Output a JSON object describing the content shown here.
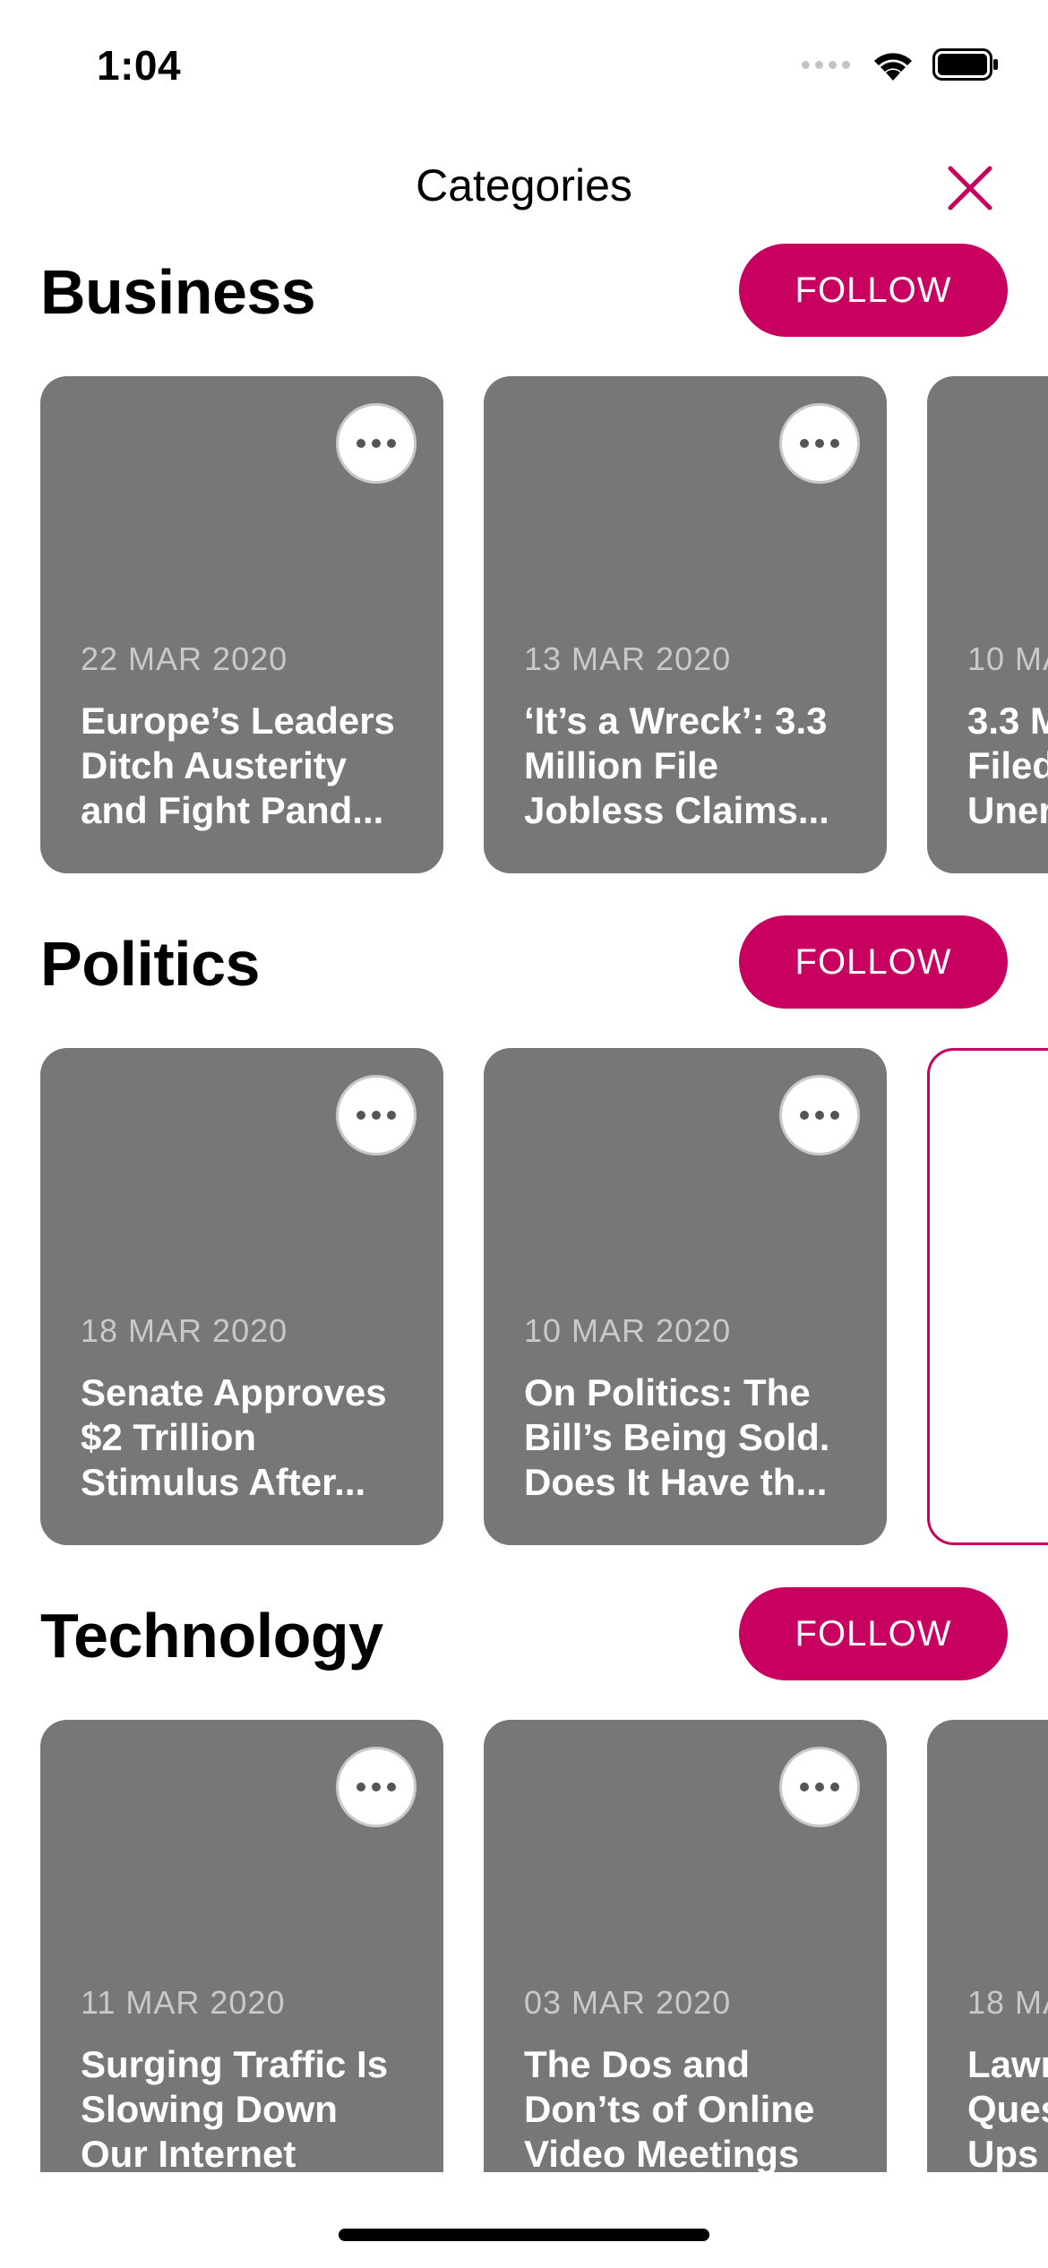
{
  "status_bar": {
    "time": "1:04"
  },
  "header": {
    "title": "Categories",
    "close_icon": "close-icon"
  },
  "colors": {
    "accent": "#c8005f",
    "card_bg": "#777777"
  },
  "sections": [
    {
      "title": "Business",
      "follow_label": "FOLLOW",
      "cards": [
        {
          "date": "22 MAR 2020",
          "headline": "Europe’s Leaders\nDitch Austerity\nand Fight Pand..."
        },
        {
          "date": "13 MAR 2020",
          "headline": "‘It’s a Wreck’: 3.3\nMillion File\nJobless Claims..."
        },
        {
          "date": "10 MA",
          "headline": "3.3 M\nFiled\nUner"
        }
      ]
    },
    {
      "title": "Politics",
      "follow_label": "FOLLOW",
      "cards": [
        {
          "date": "18 MAR 2020",
          "headline": "Senate Approves\n$2 Trillion\nStimulus After..."
        },
        {
          "date": "10 MAR 2020",
          "headline": "On Politics: The\nBill’s Being Sold.\nDoes It Have th..."
        }
      ]
    },
    {
      "title": "Technology",
      "follow_label": "FOLLOW",
      "cards": [
        {
          "date": "11 MAR 2020",
          "headline": "Surging Traffic Is\nSlowing Down\nOur Internet"
        },
        {
          "date": "03 MAR 2020",
          "headline": "The Dos and\nDon’ts of Online\nVideo Meetings"
        },
        {
          "date": "18 MA",
          "headline": "Lawr\nQues\nUps"
        }
      ]
    }
  ]
}
